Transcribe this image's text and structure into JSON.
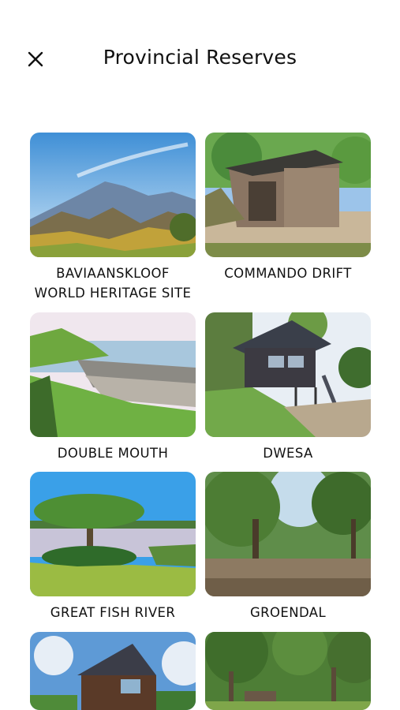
{
  "header": {
    "title": "Provincial Reserves",
    "close_icon": "close-icon"
  },
  "reserves": [
    {
      "label_line1": "BAVIAANSKLOOF",
      "label_line2": "WORLD HERITAGE SITE"
    },
    {
      "label_line1": "COMMANDO DRIFT",
      "label_line2": ""
    },
    {
      "label_line1": "DOUBLE MOUTH",
      "label_line2": ""
    },
    {
      "label_line1": "DWESA",
      "label_line2": ""
    },
    {
      "label_line1": "GREAT FISH RIVER",
      "label_line2": ""
    },
    {
      "label_line1": "GROENDAL",
      "label_line2": ""
    },
    {
      "label_line1": "",
      "label_line2": ""
    },
    {
      "label_line1": "",
      "label_line2": ""
    }
  ]
}
